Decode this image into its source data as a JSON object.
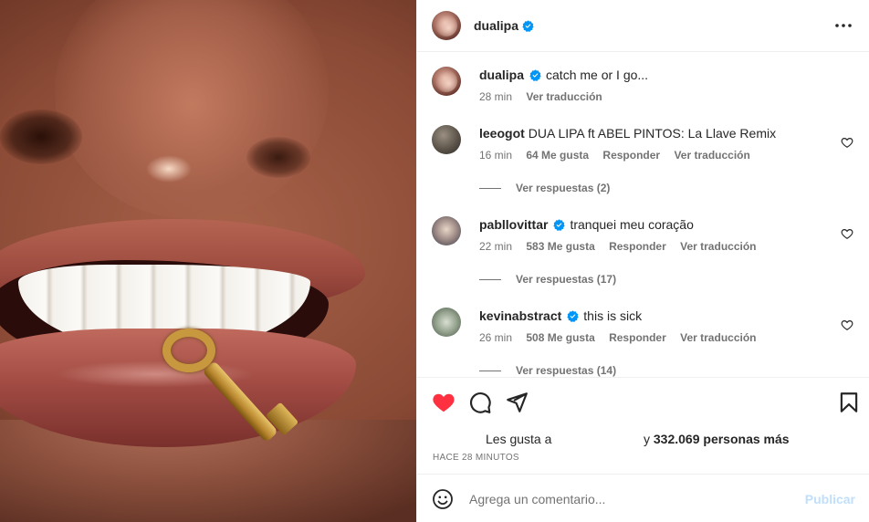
{
  "post": {
    "owner": "dualipa",
    "more_icon": "more-horizontal-icon",
    "verified_color": "#0095f6"
  },
  "caption": {
    "username": "dualipa",
    "text": "catch me or I go...",
    "time": "28 min",
    "translate": "Ver traducción"
  },
  "comments": [
    {
      "username": "leeogot",
      "verified": false,
      "text": "DUA LIPA ft ABEL PINTOS: La Llave Remix",
      "time": "16 min",
      "likes": "64 Me gusta",
      "reply": "Responder",
      "translate": "Ver traducción",
      "replies": "Ver respuestas (2)"
    },
    {
      "username": "pabllovittar",
      "verified": true,
      "text": "tranquei meu coração",
      "time": "22 min",
      "likes": "583 Me gusta",
      "reply": "Responder",
      "translate": "Ver traducción",
      "replies": "Ver respuestas (17)"
    },
    {
      "username": "kevinabstract",
      "verified": true,
      "text": "this is sick",
      "time": "26 min",
      "likes": "508 Me gusta",
      "reply": "Responder",
      "translate": "Ver traducción",
      "replies": "Ver respuestas (14)"
    }
  ],
  "actions": {
    "like_icon": "heart-filled-icon",
    "like_color": "#ff3040",
    "comment_icon": "comment-icon",
    "share_icon": "send-icon",
    "save_icon": "bookmark-icon",
    "likes_prefix": "Les gusta a",
    "likes_suffix_pre": "y",
    "likes_count": "332.069 personas más",
    "time_ago": "HACE 28 MINUTOS"
  },
  "add_comment": {
    "emoji_icon": "emoji-icon",
    "placeholder": "Agrega un comentario...",
    "publish": "Publicar"
  }
}
